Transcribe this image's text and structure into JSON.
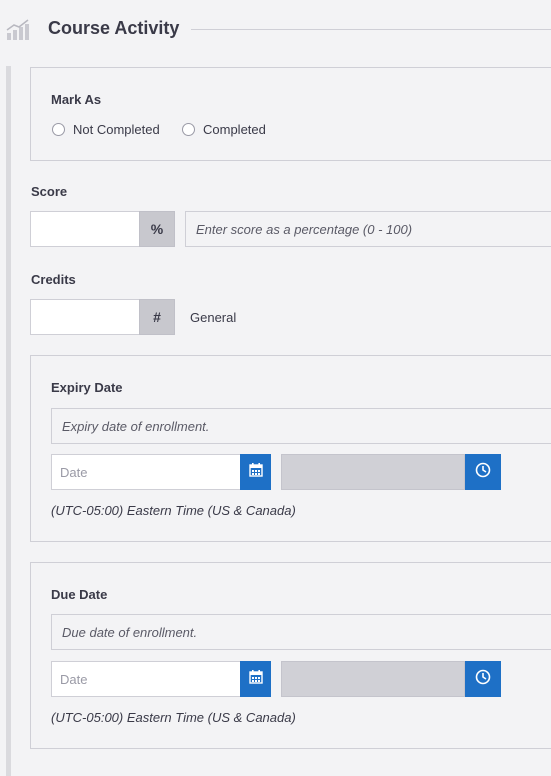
{
  "header": {
    "title": "Course Activity",
    "icon": "bar-chart-icon"
  },
  "mark_as": {
    "label": "Mark As",
    "options": [
      "Not Completed",
      "Completed"
    ],
    "selected": null
  },
  "score": {
    "label": "Score",
    "value": "",
    "addon": "%",
    "hint": "Enter score as a percentage (0 - 100)"
  },
  "credits": {
    "label": "Credits",
    "value": "",
    "addon": "#",
    "type": "General"
  },
  "expiry": {
    "label": "Expiry Date",
    "description_placeholder": "Expiry date of enrollment.",
    "date_placeholder": "Date",
    "timezone": "(UTC-05:00) Eastern Time (US & Canada)"
  },
  "due": {
    "label": "Due Date",
    "description_placeholder": "Due date of enrollment.",
    "date_placeholder": "Date",
    "timezone": "(UTC-05:00) Eastern Time (US & Canada)"
  },
  "colors": {
    "accent": "#1e70c6",
    "addon": "#c8c8ce",
    "background": "#f3f3f5"
  }
}
